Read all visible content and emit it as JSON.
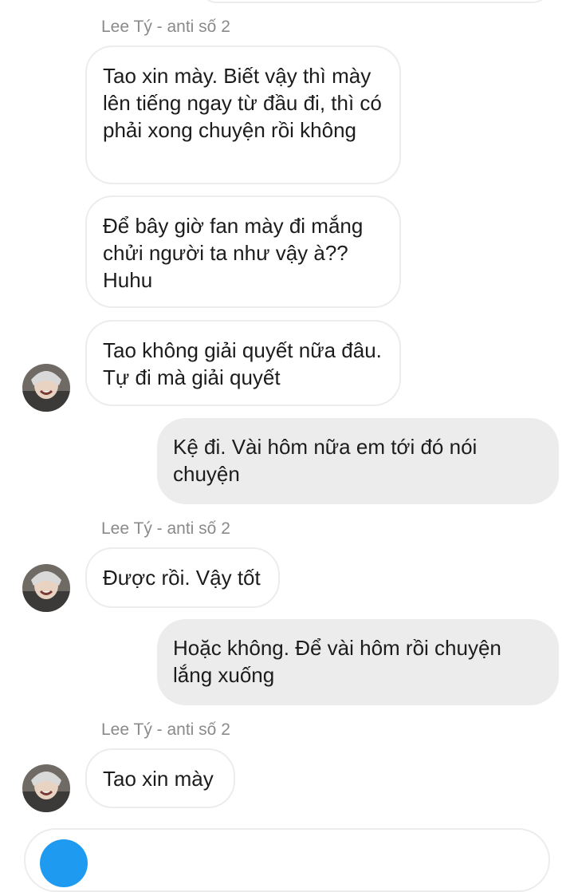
{
  "sender_name": "Lee Tý - anti số 2",
  "messages": [
    {
      "dir": "in",
      "text": "Tao xin mày. Biết vậy thì mày lên tiếng ngay từ đầu đi, thì có phải xong chuyện rồi không"
    },
    {
      "dir": "in",
      "text": "Để bây giờ fan mày đi mắng chửi người ta như vậy à?? Huhu"
    },
    {
      "dir": "in",
      "text": "Tao không giải quyết nữa đâu. Tự đi mà giải quyết"
    },
    {
      "dir": "out",
      "text": "Kệ đi. Vài hôm nữa em tới đó nói chuyện"
    },
    {
      "dir": "in",
      "text": "Được rồi. Vậy tốt"
    },
    {
      "dir": "out",
      "text": "Hoặc không. Để vài hôm rồi chuyện lắng xuống"
    },
    {
      "dir": "in",
      "text": "Tao xin mày"
    }
  ],
  "colors": {
    "outgoing_bubble": "#ececec",
    "incoming_border": "#ececec",
    "sender_label": "#8a8a8a",
    "accent": "#1e9bf0"
  },
  "icons": {
    "avatar": "avatar-image"
  }
}
